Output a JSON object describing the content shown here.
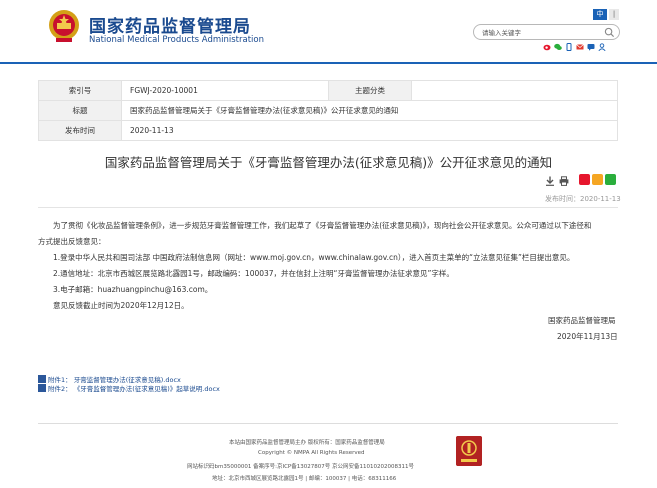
{
  "header": {
    "title_cn": "国家药品监督管理局",
    "title_en": "National Medical Products Administration",
    "lang_cn": "中",
    "lang_other": "|",
    "search_placeholder": "请输入关键字"
  },
  "meta": {
    "index_label": "索引号",
    "index_value": "FGWJ-2020-10001",
    "topic_label": "主题分类",
    "topic_value": "",
    "title_label": "标题",
    "title_value": "国家药品监督管理局关于《牙膏监督管理办法(征求意见稿)》公开征求意见的通知",
    "date_label": "发布时间",
    "date_value": "2020-11-13"
  },
  "article": {
    "title": "国家药品监督管理局关于《牙膏监督管理办法(征求意见稿)》公开征求意见的通知",
    "pubtime": "发布时间：2020-11-13",
    "p1a": "为了贯彻《化妆品监督管理条例》，进一步规范牙膏监督管理工作，我们起草了《牙膏监督管理办法(征求意见稿)》，现向社会公开征求意见。公众可通过以下途径和",
    "p1b": "方式提出反馈意见：",
    "item1": "1.登录中华人民共和国司法部 中国政府法制信息网（网址：www.moj.gov.cn，www.chinalaw.gov.cn），进入首页主菜单的“立法意见征集”栏目提出意见。",
    "item2": "2.通信地址：北京市西城区展览路北露园1号，邮政编码：100037，并在信封上注明“牙膏监督管理办法征求意见”字样。",
    "item3": "3.电子邮箱：huazhuangpinchu@163.com。",
    "deadline": "意见反馈截止时间为2020年12月12日。",
    "sign_org": "国家药品监督管理局",
    "sign_date": "2020年11月13日"
  },
  "attachments": [
    "附件1：  牙膏监督管理办法(征求意见稿).docx",
    "附件2：  《牙膏监督管理办法(征求意见稿)》起草说明.docx"
  ],
  "footer": {
    "line1": "本站由国家药品监督管理局主办 版权所有：国家药品监督管理局",
    "line2": "Copyright © NMPA All Rights Reserved",
    "line3": "网站标识码bm35000001    备案序号:京ICP备13027807号    京公网安备11010202008311号",
    "line4": "地址：北京市西城区展览路北露园1号 | 邮编：100037 | 电话：68311166"
  },
  "icons": {
    "emblem": "national-emblem-icon",
    "search": "search-icon",
    "weibo": "weibo-icon",
    "wechat": "wechat-icon",
    "mobile": "mobile-icon",
    "email": "email-icon",
    "message": "message-icon",
    "user": "user-icon",
    "download": "download-icon",
    "print": "print-icon",
    "badge": "government-site-badge-icon"
  }
}
